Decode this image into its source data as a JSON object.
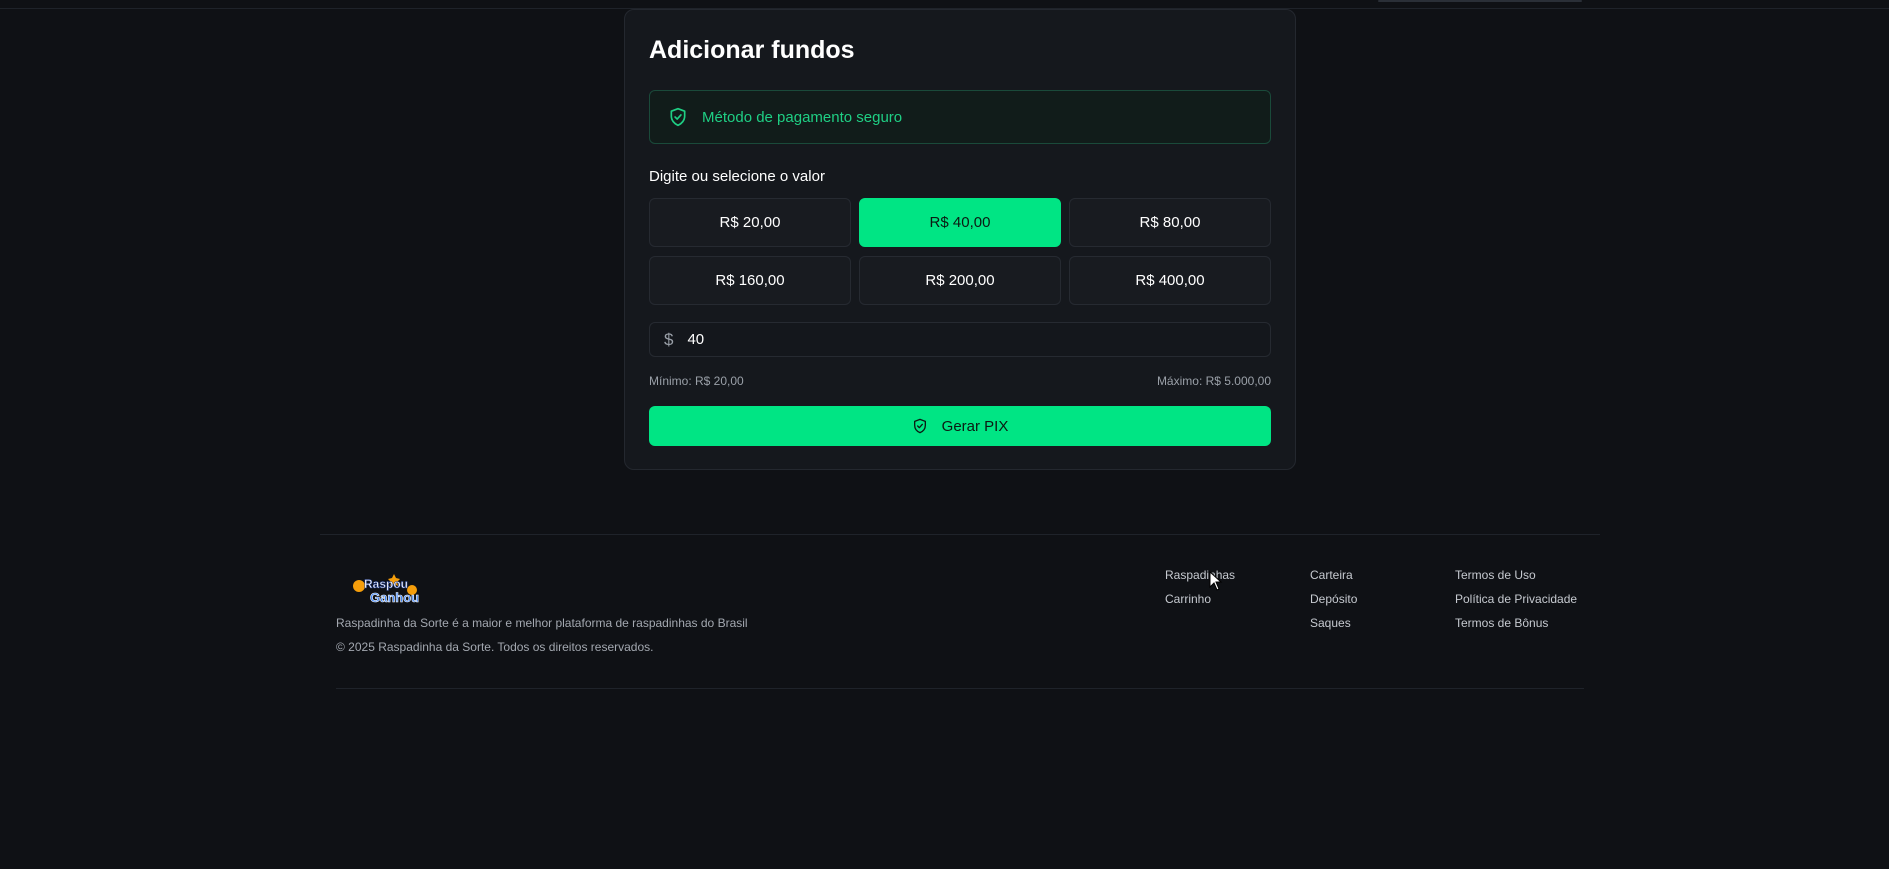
{
  "card": {
    "title": "Adicionar fundos",
    "secure_text": "Método de pagamento seguro",
    "section_label": "Digite ou selecione o valor",
    "amounts": [
      "R$ 20,00",
      "R$ 40,00",
      "R$ 80,00",
      "R$ 160,00",
      "R$ 200,00",
      "R$ 400,00"
    ],
    "selected_amount": "R$ 40,00",
    "currency_symbol": "$",
    "input_value": "40",
    "min_label": "Mínimo: R$ 20,00",
    "max_label": "Máximo: R$ 5.000,00",
    "submit_label": "Gerar PIX"
  },
  "footer": {
    "logo_text_1": "Raspou",
    "logo_text_2": "Ganhou",
    "description": "Raspadinha da Sorte é a maior e melhor plataforma de raspadinhas do Brasil",
    "copyright": "© 2025 Raspadinha da Sorte. Todos os direitos reservados.",
    "col1": [
      "Raspadinhas",
      "Carrinho"
    ],
    "col2": [
      "Carteira",
      "Depósito",
      "Saques"
    ],
    "col3": [
      "Termos de Uso",
      "Política de Privacidade",
      "Termos de Bônus"
    ]
  },
  "colors": {
    "accent": "#00e584",
    "background": "#0f1115",
    "card": "#15181d",
    "secure_text": "#1fcf84"
  },
  "icons": {
    "secure": "shield-check-icon",
    "submit": "shield-check-icon",
    "cursor": "mouse-cursor-icon"
  }
}
